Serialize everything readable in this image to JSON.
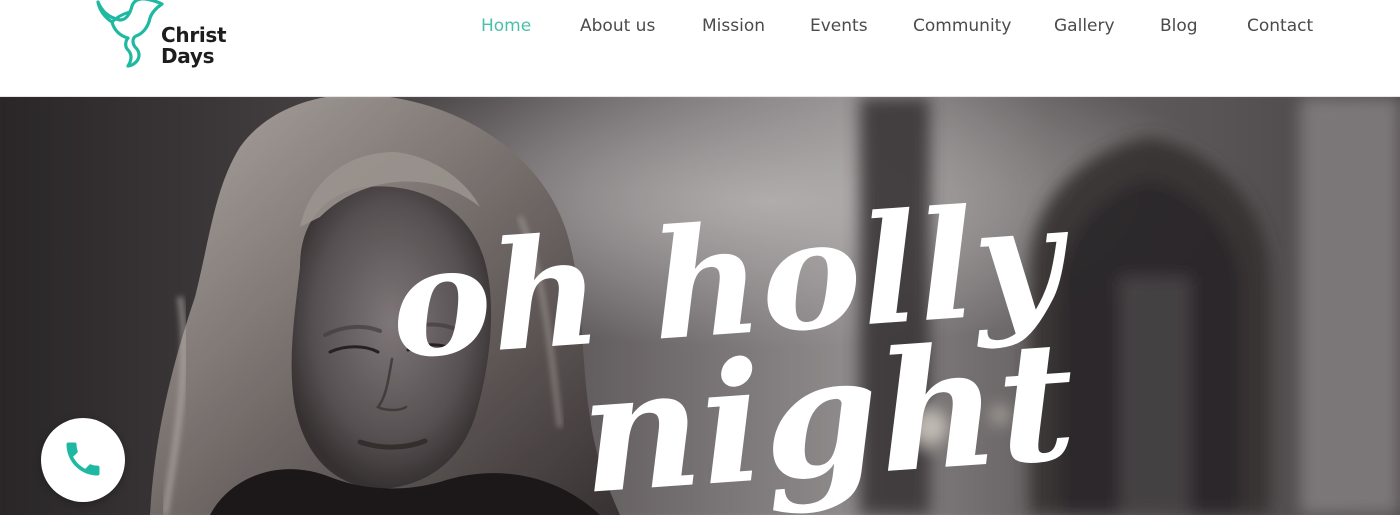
{
  "brand": {
    "name_line1": "Christ",
    "name_line2": "Days",
    "logo_icon": "dove-icon",
    "accent_color": "#1fb9a2"
  },
  "nav": {
    "items": [
      {
        "label": "Home",
        "active": true
      },
      {
        "label": "About us",
        "active": false
      },
      {
        "label": "Mission",
        "active": false
      },
      {
        "label": "Events",
        "active": false
      },
      {
        "label": "Community",
        "active": false
      },
      {
        "label": "Gallery",
        "active": false
      },
      {
        "label": "Blog",
        "active": false
      },
      {
        "label": "Contact",
        "active": false
      }
    ],
    "active_color": "#4cbfaa",
    "text_color": "#4b4b4b"
  },
  "hero": {
    "line1": "oh holly",
    "line2": "night",
    "image": "woman-photo"
  },
  "call_button": {
    "icon": "phone-icon",
    "icon_color": "#1fb9a2"
  }
}
